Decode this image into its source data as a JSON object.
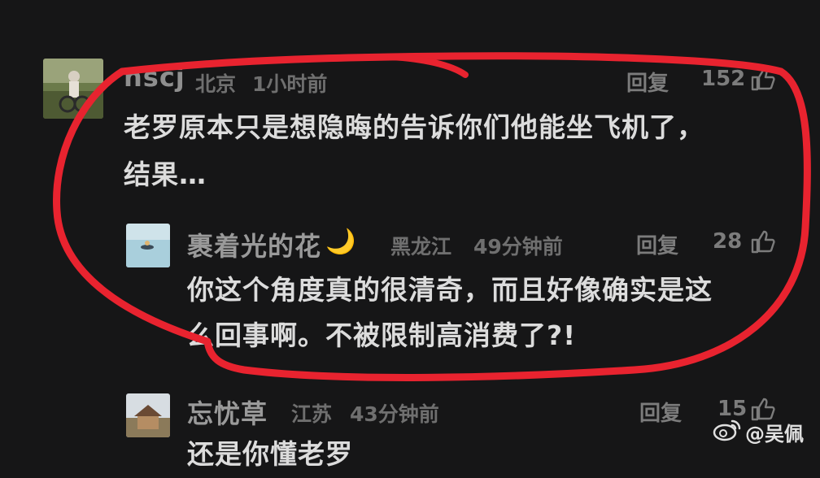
{
  "comments": [
    {
      "username": "nscj",
      "location": "北京",
      "time": "1小时前",
      "reply_label": "回复",
      "likes": "152",
      "text_lines": [
        "老罗原本只是想隐晦的告诉你们他能坐飞机了，",
        "结果…"
      ],
      "avatar_icon": "person-on-bike-photo"
    },
    {
      "username": "裹着光的花",
      "name_emoji": "🌙",
      "location": "黑龙江",
      "time": "49分钟前",
      "reply_label": "回复",
      "likes": "28",
      "text_lines": [
        "你这个角度真的很清奇，而且好像确实是这",
        "么回事啊。不被限制高消费了?!"
      ],
      "avatar_icon": "boat-on-water-photo"
    },
    {
      "username": "忘忧草",
      "location": "江苏",
      "time": "43分钟前",
      "reply_label": "回复",
      "likes": "15",
      "text_lines": [
        "还是你懂老罗"
      ],
      "avatar_icon": "house-photo"
    }
  ],
  "watermark": {
    "icon": "weibo-logo-icon",
    "text": "@吴佩"
  },
  "colors": {
    "background": "#161617",
    "highlight_circle": "#e8232f"
  }
}
